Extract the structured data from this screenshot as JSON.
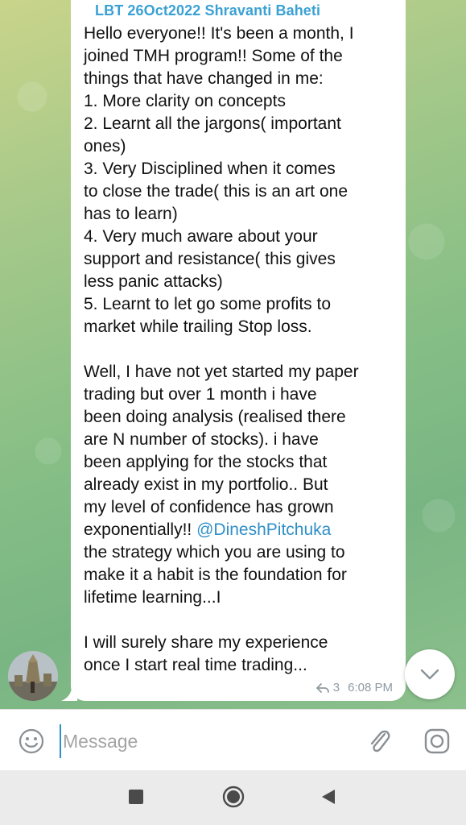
{
  "message": {
    "sender": "LBT 26Oct2022 Shravanti Baheti",
    "lines": [
      "Hello everyone!! It's been a month,  I",
      "joined TMH program!! Some of the",
      "things that have changed in me:",
      "1. More clarity on concepts",
      "2. Learnt all the jargons( important",
      "ones)",
      "3. Very Disciplined when it comes",
      "to close the trade( this is an art one",
      "has to learn)",
      "4. Very much aware about your",
      "support and resistance( this gives",
      "less panic attacks)",
      "5. Learnt to let go some profits to",
      "market while trailing Stop loss.",
      "",
      "Well, I have not yet started my paper",
      "trading but over 1 month i have",
      "been doing analysis (realised there",
      "are N number of stocks). i have",
      "been applying for the stocks that",
      "already exist in my portfolio.. But",
      "my level of confidence has grown"
    ],
    "mention_line_prefix": "exponentially!! ",
    "mention": "@DineshPitchuka",
    "lines_after_mention": [
      "the strategy which you are using to",
      "make it a habit is the foundation for",
      "lifetime learning...I",
      "",
      "I will surely share my experience",
      "once I start real time trading..."
    ],
    "reply_count": "3",
    "time": "6:08 PM"
  },
  "input": {
    "placeholder": "Message",
    "value": ""
  },
  "icons": {
    "emoji": "smile-icon",
    "attach": "paperclip-icon",
    "camera": "camera-icon",
    "scroll_down": "chevron-down-icon",
    "reply": "reply-arrow-icon"
  },
  "colors": {
    "sender": "#3aa1d4",
    "mention": "#2f8fc7",
    "meta": "#8f9aa1",
    "bubble": "#ffffff"
  }
}
